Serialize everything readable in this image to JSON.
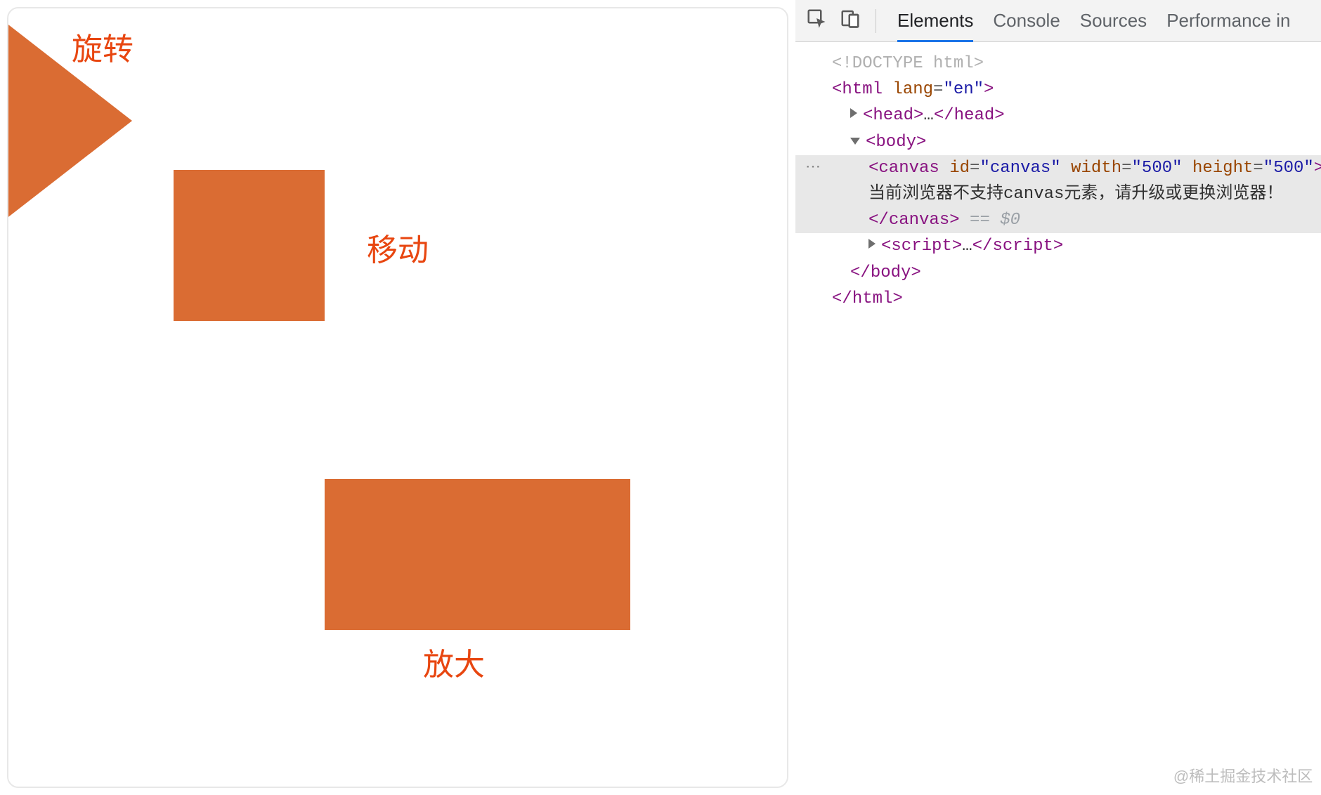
{
  "canvas": {
    "labels": {
      "rotate": "旋转",
      "move": "移动",
      "scale": "放大"
    },
    "shape_color": "#da6c33",
    "label_color": "#e84610"
  },
  "devtools": {
    "tabs": {
      "elements": "Elements",
      "console": "Console",
      "sources": "Sources",
      "performance": "Performance in"
    },
    "icons": {
      "inspect": "inspect-element-icon",
      "device_toggle": "device-toolbar-icon"
    },
    "html_tree": {
      "doctype": "<!DOCTYPE html>",
      "html_open": "<html lang=\"en\">",
      "head_line": {
        "open": "<head>",
        "ell": "…",
        "close": "</head>"
      },
      "body_open": "<body>",
      "canvas_line": {
        "tag": "canvas",
        "attrs": [
          [
            "id",
            "canvas"
          ],
          [
            "width",
            "500"
          ],
          [
            "height",
            "500"
          ]
        ]
      },
      "canvas_fallback": "当前浏览器不支持canvas元素，请升级或更换浏览器！",
      "canvas_close": "</canvas>",
      "selected_hint": " == $0",
      "script_line": {
        "open": "<script>",
        "ell": "…",
        "close": "</script>"
      },
      "body_close": "</body>",
      "html_close": "</html>",
      "gutter_dots": "⋯"
    }
  },
  "watermark": "@稀土掘金技术社区"
}
